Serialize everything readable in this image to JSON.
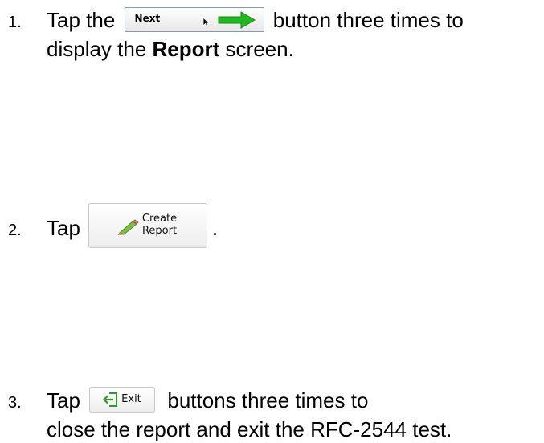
{
  "steps": [
    {
      "number": "1.",
      "text_before": "Tap the",
      "text_after": "button three times to",
      "line2_before": "display the ",
      "line2_bold": "Report",
      "line2_after": " screen."
    },
    {
      "number": "2.",
      "text_before": "Tap",
      "text_after": "."
    },
    {
      "number": "3.",
      "text_before": "Tap",
      "text_after": "buttons three times to",
      "line2": "close the report and exit the RFC-2544 test."
    }
  ],
  "buttons": {
    "next": {
      "label": "Next",
      "icon": "green-arrow-right-icon",
      "cursor": "mouse-pointer-icon",
      "color": "#22b822"
    },
    "create_report": {
      "label_line1": "Create",
      "label_line2": "Report",
      "icon": "pencil-icon"
    },
    "exit": {
      "label": "Exit",
      "icon": "exit-door-icon",
      "color": "#2a9d2a"
    }
  }
}
